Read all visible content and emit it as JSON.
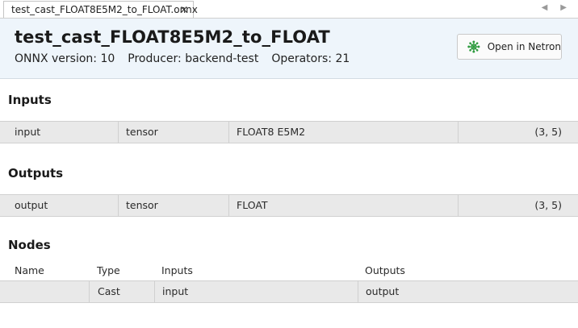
{
  "tab": {
    "label": "test_cast_FLOAT8E5M2_to_FLOAT.onnx",
    "close_glyph": "×"
  },
  "header": {
    "title": "test_cast_FLOAT8E5M2_to_FLOAT",
    "onnx_version": "ONNX version: 10",
    "producer": "Producer: backend-test",
    "operators": "Operators: 21",
    "open_button_label": "Open in Netron",
    "open_button_icon": "netron-icon",
    "accent_color": "#2e9b3f"
  },
  "inputs": {
    "title": "Inputs",
    "rows": [
      {
        "name": "input",
        "kind": "tensor",
        "dtype": "FLOAT8 E5M2",
        "shape": "(3, 5)"
      }
    ]
  },
  "outputs": {
    "title": "Outputs",
    "rows": [
      {
        "name": "output",
        "kind": "tensor",
        "dtype": "FLOAT",
        "shape": "(3, 5)"
      }
    ]
  },
  "nodes": {
    "title": "Nodes",
    "columns": [
      "Name",
      "Type",
      "Inputs",
      "Outputs"
    ],
    "rows": [
      {
        "name": "",
        "type": "Cast",
        "inputs": "input",
        "outputs": "output"
      }
    ]
  }
}
